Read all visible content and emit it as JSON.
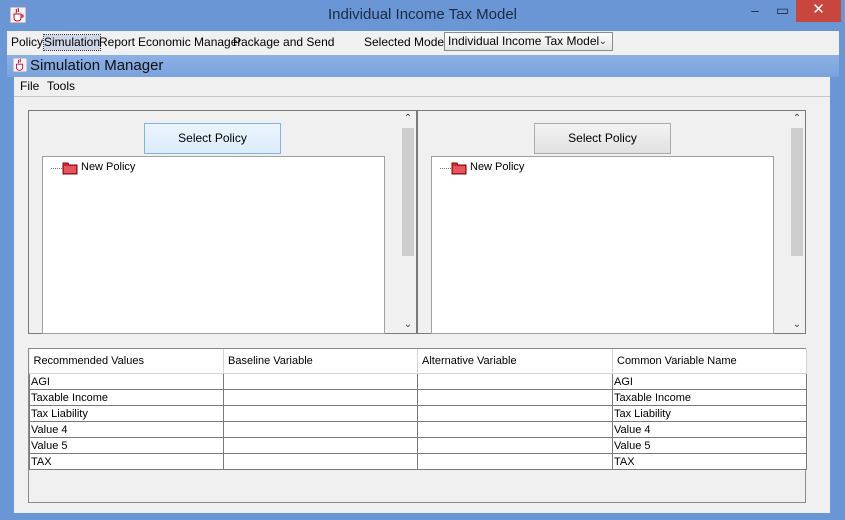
{
  "window": {
    "title": "Individual Income Tax Model",
    "min": "–",
    "max": "▭",
    "close": "✕"
  },
  "menubar": {
    "items": [
      "Policy",
      "Simulation",
      "Report",
      "Economic Manager",
      "Package and Send"
    ],
    "selected_model_label": "Selected Model:",
    "selected_model_value": "Individual Income Tax Model"
  },
  "simulation_manager": {
    "title": "Simulation Manager",
    "menu": [
      "File",
      "Tools"
    ],
    "left_panel": {
      "button": "Select Policy",
      "tree_item": "New Policy"
    },
    "right_panel": {
      "button": "Select Policy",
      "tree_item": "New Policy"
    },
    "table": {
      "headers": [
        "Recommended Values",
        "Baseline Variable",
        "Alternative Variable",
        "Common Variable Name"
      ],
      "rows": [
        [
          "AGI",
          "",
          "",
          "AGI"
        ],
        [
          "Taxable Income",
          "",
          "",
          "Taxable Income"
        ],
        [
          "Tax Liability",
          "",
          "",
          "Tax Liability"
        ],
        [
          "Value 4",
          "",
          "",
          "Value 4"
        ],
        [
          "Value 5",
          "",
          "",
          "Value 5"
        ],
        [
          "TAX",
          "",
          "",
          "TAX"
        ]
      ]
    }
  },
  "colors": {
    "window_frame": "#6b96d6",
    "close_button": "#c7473f",
    "folder_icon": "#d9232e"
  }
}
